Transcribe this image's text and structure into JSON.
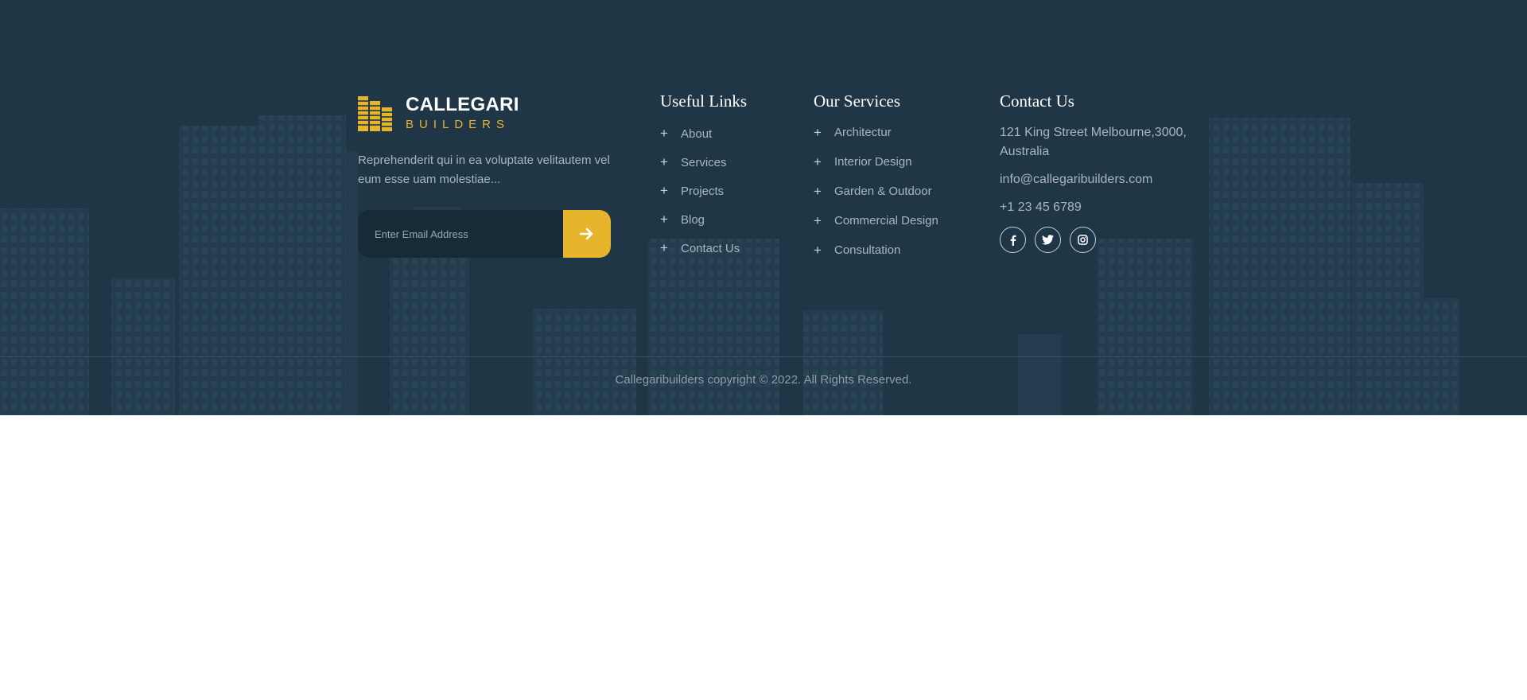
{
  "brand": {
    "name": "CALLEGARI",
    "tagline": "BUILDERS",
    "description": "Reprehenderit qui in ea voluptate velitautem vel eum esse uam molestiae...",
    "logo_icon": "buildings-logo-icon"
  },
  "subscribe": {
    "placeholder": "Enter Email Address",
    "button_icon": "arrow-right-icon"
  },
  "useful_links": {
    "heading": "Useful Links",
    "items": [
      {
        "label": "About"
      },
      {
        "label": "Services"
      },
      {
        "label": "Projects"
      },
      {
        "label": "Blog"
      },
      {
        "label": "Contact Us"
      }
    ]
  },
  "services": {
    "heading": "Our Services",
    "items": [
      {
        "label": "Architectur"
      },
      {
        "label": "Interior Design"
      },
      {
        "label": "Garden & Outdoor"
      },
      {
        "label": "Commercial Design"
      },
      {
        "label": "Consultation"
      }
    ]
  },
  "contact": {
    "heading": "Contact Us",
    "address": "121 King Street Melbourne,3000, Australia",
    "email": "info@callegaribuilders.com",
    "phone": "+1 23 45 6789",
    "social": [
      {
        "icon": "facebook-icon"
      },
      {
        "icon": "twitter-icon"
      },
      {
        "icon": "instagram-icon"
      }
    ]
  },
  "copyright": "Callegaribuilders copyright © 2022. All Rights Reserved.",
  "colors": {
    "background": "#1f3646",
    "accent": "#e7b52c",
    "text_muted": "#a9b6c0",
    "heading": "#ffffff"
  }
}
